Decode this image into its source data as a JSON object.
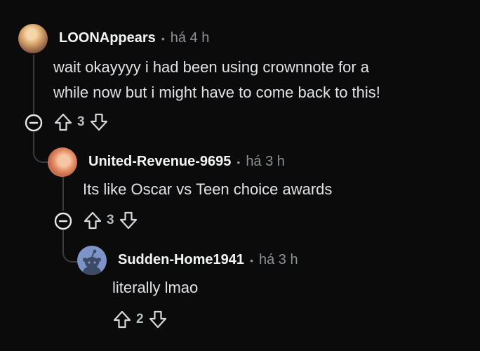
{
  "comments": [
    {
      "username": "LOONAppears",
      "separator": "•",
      "time": "há 4 h",
      "text_lines": [
        "wait okayyyy i had been using crownnote for a",
        "while now but i might have to come back to this!"
      ],
      "votes": "3"
    },
    {
      "username": "United-Revenue-9695",
      "separator": "•",
      "time": "há 3 h",
      "text": "Its like Oscar vs Teen choice awards",
      "votes": "3"
    },
    {
      "username": "Sudden-Home1941",
      "separator": "•",
      "time": "há 3 h",
      "text": "literally lmao",
      "votes": "2"
    }
  ],
  "icons": {
    "upvote": "arrow-up-outline",
    "downvote": "arrow-down-outline",
    "collapse": "minus-circle"
  },
  "colors": {
    "background": "#0b0b0b",
    "text": "#e0e3e6",
    "muted": "#8b9195",
    "thread_line": "#3a3d40",
    "snoo_avatar": "#7d94c8"
  }
}
